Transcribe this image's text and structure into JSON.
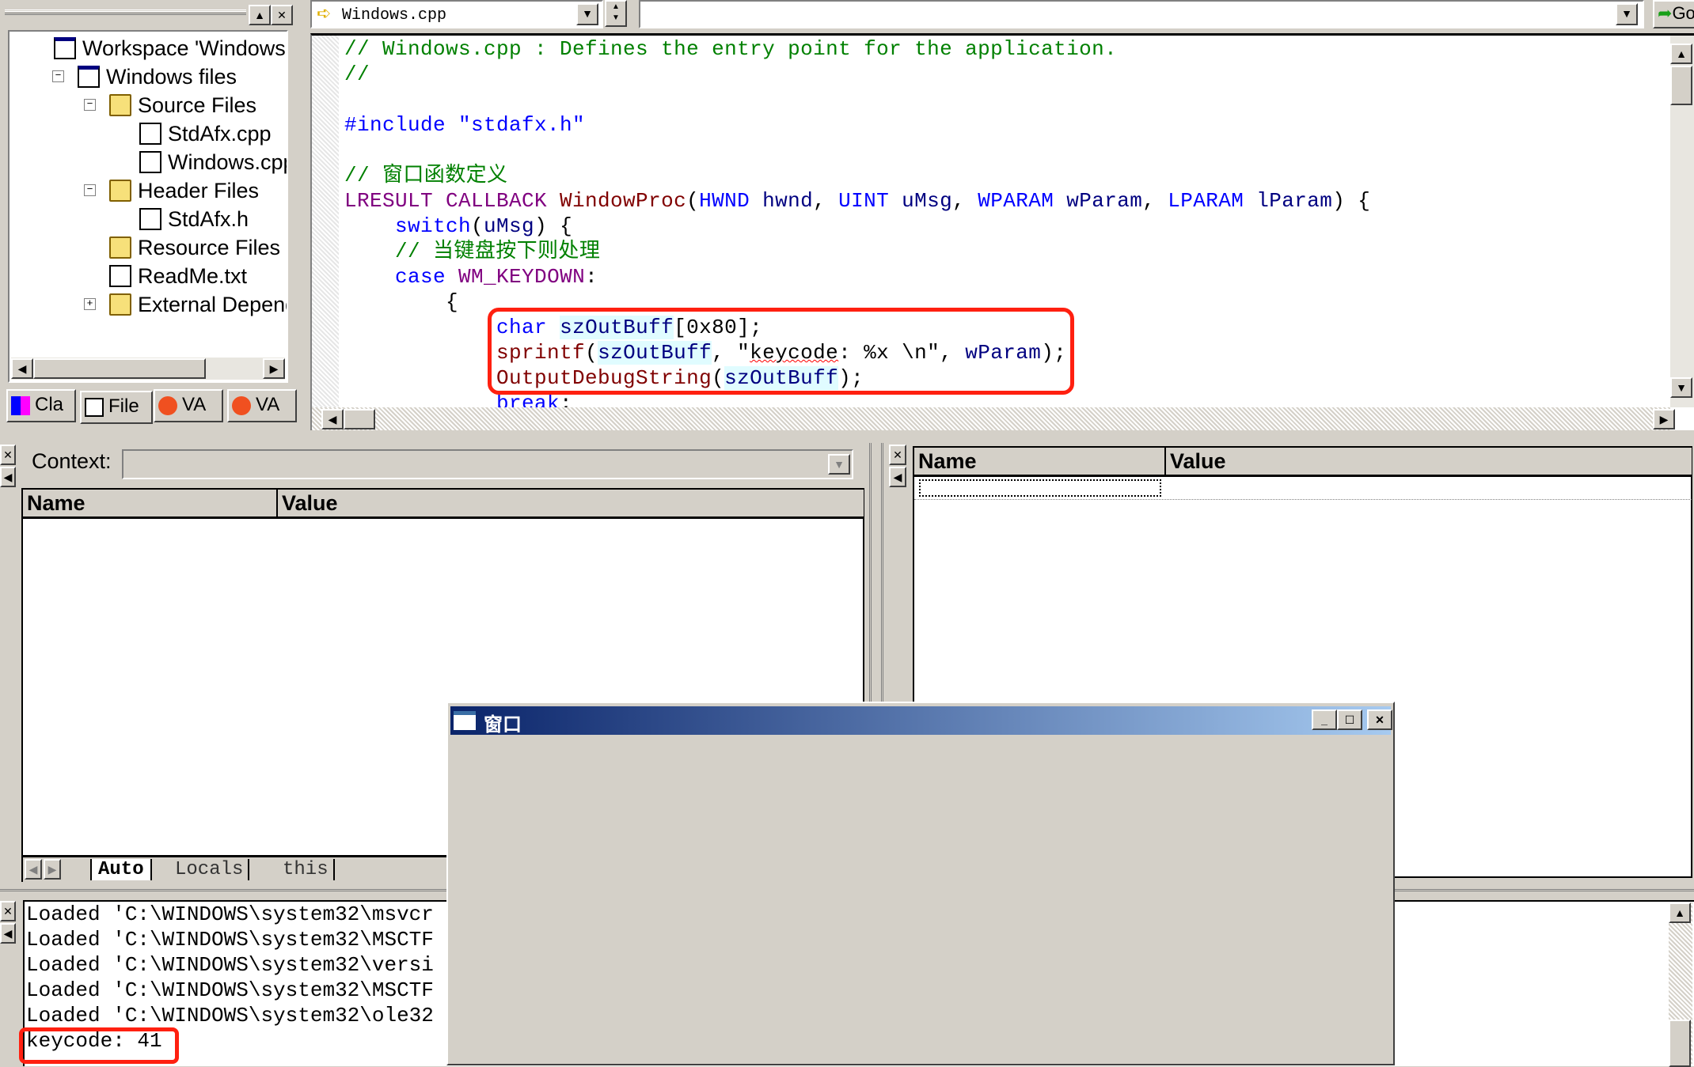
{
  "workspace": {
    "tree": [
      {
        "label": "Workspace 'Windows':",
        "icon": "workspace-icon",
        "level": 0,
        "expander": ""
      },
      {
        "label": "Windows files",
        "icon": "project-icon",
        "level": 1,
        "expander": "-"
      },
      {
        "label": "Source Files",
        "icon": "folder-open-icon",
        "level": 2,
        "expander": "-"
      },
      {
        "label": "StdAfx.cpp",
        "icon": "cpp-file-icon",
        "level": 3,
        "expander": ""
      },
      {
        "label": "Windows.cpp",
        "icon": "cpp-file-icon",
        "level": 3,
        "expander": ""
      },
      {
        "label": "Header Files",
        "icon": "folder-open-icon",
        "level": 2,
        "expander": "-"
      },
      {
        "label": "StdAfx.h",
        "icon": "header-file-icon",
        "level": 3,
        "expander": ""
      },
      {
        "label": "Resource Files",
        "icon": "folder-icon",
        "level": 2,
        "expander": ""
      },
      {
        "label": "ReadMe.txt",
        "icon": "text-file-icon",
        "level": 2,
        "expander": ""
      },
      {
        "label": "External Depend",
        "icon": "folder-icon",
        "level": 2,
        "expander": "+"
      }
    ],
    "tabs": [
      {
        "label": "Cla",
        "icon": "class-view-icon"
      },
      {
        "label": "File",
        "icon": "file-view-icon",
        "active": true
      },
      {
        "label": "VA",
        "icon": "visual-assist-icon"
      },
      {
        "label": "VA",
        "icon": "visual-assist-outline-icon"
      }
    ]
  },
  "editor": {
    "file_combo": "Windows.cpp",
    "go_label": "Go",
    "colors": {
      "comment": "#008000",
      "keyword": "#0000ff",
      "macro": "#800080",
      "func": "#800000",
      "ident": "#000080",
      "plain": "#000000"
    },
    "lines": [
      [
        {
          "t": "// Windows.cpp : Defines the entry point for the application.",
          "c": "comment"
        }
      ],
      [
        {
          "t": "//",
          "c": "comment"
        }
      ],
      [],
      [
        {
          "t": "#include \"stdafx.h\"",
          "c": "keyword"
        }
      ],
      [],
      [
        {
          "t": "// 窗口函数定义",
          "c": "comment"
        }
      ],
      [
        {
          "t": "LRESULT CALLBACK ",
          "c": "macro"
        },
        {
          "t": "WindowProc",
          "c": "func"
        },
        {
          "t": "(",
          "c": "plain"
        },
        {
          "t": "HWND",
          "c": "keyword"
        },
        {
          "t": " hwnd",
          "c": "ident"
        },
        {
          "t": ", ",
          "c": "plain"
        },
        {
          "t": "UINT",
          "c": "keyword"
        },
        {
          "t": " uMsg",
          "c": "ident"
        },
        {
          "t": ", ",
          "c": "plain"
        },
        {
          "t": "WPARAM",
          "c": "keyword"
        },
        {
          "t": " wParam",
          "c": "ident"
        },
        {
          "t": ", ",
          "c": "plain"
        },
        {
          "t": "LPARAM",
          "c": "keyword"
        },
        {
          "t": " lParam",
          "c": "ident"
        },
        {
          "t": ") {",
          "c": "plain"
        }
      ],
      [
        {
          "t": "    ",
          "c": "plain"
        },
        {
          "t": "switch",
          "c": "keyword"
        },
        {
          "t": "(",
          "c": "plain"
        },
        {
          "t": "uMsg",
          "c": "ident"
        },
        {
          "t": ") {",
          "c": "plain"
        }
      ],
      [
        {
          "t": "    // 当键盘按下则处理",
          "c": "comment"
        }
      ],
      [
        {
          "t": "    ",
          "c": "plain"
        },
        {
          "t": "case",
          "c": "keyword"
        },
        {
          "t": " ",
          "c": "plain"
        },
        {
          "t": "WM_KEYDOWN",
          "c": "macro"
        },
        {
          "t": ":",
          "c": "plain"
        }
      ],
      [
        {
          "t": "        {",
          "c": "plain"
        }
      ],
      [
        {
          "t": "            ",
          "c": "plain"
        },
        {
          "t": "char",
          "c": "keyword"
        },
        {
          "t": " ",
          "c": "plain"
        },
        {
          "t": "szOutBuff",
          "c": "ident",
          "hl": true
        },
        {
          "t": "[0x80];",
          "c": "plain"
        }
      ],
      [
        {
          "t": "            ",
          "c": "plain"
        },
        {
          "t": "sprintf",
          "c": "func"
        },
        {
          "t": "(",
          "c": "plain"
        },
        {
          "t": "szOutBuff",
          "c": "ident",
          "hl": true
        },
        {
          "t": ", \"",
          "c": "plain"
        },
        {
          "t": "keycode",
          "c": "plain",
          "squiggle": true
        },
        {
          "t": ": %x \\n\", ",
          "c": "plain"
        },
        {
          "t": "wParam",
          "c": "ident"
        },
        {
          "t": ");",
          "c": "plain"
        }
      ],
      [
        {
          "t": "            ",
          "c": "plain"
        },
        {
          "t": "OutputDebugString",
          "c": "func"
        },
        {
          "t": "(",
          "c": "plain"
        },
        {
          "t": "szOutBuff",
          "c": "ident",
          "hl": true
        },
        {
          "t": ");",
          "c": "plain"
        }
      ],
      [
        {
          "t": "            ",
          "c": "plain"
        },
        {
          "t": "break",
          "c": "keyword"
        },
        {
          "t": ";",
          "c": "plain"
        }
      ]
    ],
    "annotation_color": "#ff2010"
  },
  "variables": {
    "context_label": "Context:",
    "context_value": "",
    "columns": [
      "Name",
      "Value"
    ],
    "tabs": [
      "Auto",
      "Locals",
      "this"
    ],
    "active_tab": "Auto"
  },
  "watch": {
    "columns": [
      "Name",
      "Value"
    ]
  },
  "output": {
    "lines": [
      "Loaded 'C:\\WINDOWS\\system32\\msvcr",
      "Loaded 'C:\\WINDOWS\\system32\\MSCTF",
      "Loaded 'C:\\WINDOWS\\system32\\versi",
      "Loaded 'C:\\WINDOWS\\system32\\MSCTF",
      "Loaded 'C:\\WINDOWS\\system32\\ole32",
      "keycode: 41"
    ]
  },
  "app_window": {
    "title": "窗口",
    "title_gradient": [
      "#0a246a",
      "#a6caf0"
    ]
  }
}
